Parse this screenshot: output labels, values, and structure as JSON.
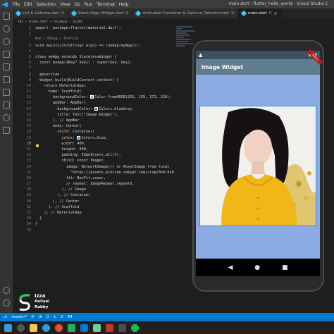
{
  "window": {
    "title": "main.dart - flutter_hello_world - Visual Studio C",
    "menu": [
      "File",
      "Edit",
      "Selection",
      "View",
      "Go",
      "Run",
      "Terminal",
      "Help"
    ]
  },
  "tabs": [
    {
      "label": "List & Listview.dart",
      "badge": "U"
    },
    {
      "label": "Stack Align Widget.dart",
      "badge": "U"
    },
    {
      "label": "Animated Container & Gesture Detector.dart",
      "badge": "U"
    },
    {
      "label": "main.dart",
      "badge": "U"
    }
  ],
  "breadcrumb": [
    "lib",
    "main.dart",
    "myApp",
    "build"
  ],
  "editor": {
    "codelens": "Run | Debug | Profile",
    "lines": [
      {
        "n": "1",
        "text": "import 'package:flutter/material.dart';"
      },
      {
        "n": "2",
        "text": ""
      },
      {
        "n": "",
        "text": "Run | Debug | Profile",
        "lens": true
      },
      {
        "n": "3",
        "text": "void main(List<String> args) => runApp(myApp());"
      },
      {
        "n": "4",
        "text": ""
      },
      {
        "n": "5",
        "text": "class myApp extends StatelessWidget {"
      },
      {
        "n": "6",
        "text": "  const myApp({Key? key}) : super(key: key);"
      },
      {
        "n": "7",
        "text": ""
      },
      {
        "n": "8",
        "text": "  @override"
      },
      {
        "n": "9",
        "text": "  Widget build(BuildContext context) {"
      },
      {
        "n": "10",
        "text": "    return MaterialApp("
      },
      {
        "n": "11",
        "text": "      home: Scaffold("
      },
      {
        "n": "12",
        "text": "        backgroundColor:  Color.fromARGB(255, 139, 171, 226),",
        "swatch": "#8babe2"
      },
      {
        "n": "13",
        "text": "        appBar: AppBar("
      },
      {
        "n": "14",
        "text": "          backgroundColor:  Colors.blueGrey,",
        "swatch": "#607d8b"
      },
      {
        "n": "15",
        "text": "          title: Text(\"Image Widget\"),"
      },
      {
        "n": "16",
        "text": "        ), // AppBar"
      },
      {
        "n": "17",
        "text": "        body: Center("
      },
      {
        "n": "18",
        "text": "          child: Container("
      },
      {
        "n": "19",
        "text": "            color:  Colors.blue,",
        "swatch": "#2196f3"
      },
      {
        "n": "20",
        "text": "            width: 400,"
      },
      {
        "n": "21",
        "text": "            height: 400,"
      },
      {
        "n": "22",
        "text": "            padding: EdgeInsets.all(3),"
      },
      {
        "n": "23",
        "text": "            child: const Image("
      },
      {
        "n": "24",
        "text": "              image: NetworkImage(// or AssetImage from local"
      },
      {
        "n": "25",
        "text": "                \"https://assets.pikiran-rakyat.com/crop/0x0:0x0"
      },
      {
        "n": "26",
        "text": "              fit: BoxFit.cover,"
      },
      {
        "n": "27",
        "text": "              // repeat: ImageRepeat.repeatX,"
      },
      {
        "n": "28",
        "text": "            ), // Image"
      },
      {
        "n": "29",
        "text": "          ), // Container"
      },
      {
        "n": "30",
        "text": "        ), // Center"
      },
      {
        "n": "31",
        "text": "      ), // Scaffold"
      },
      {
        "n": "32",
        "text": "    ); // MaterialApp"
      },
      {
        "n": "33",
        "text": "  }"
      },
      {
        "n": "34",
        "text": "}"
      },
      {
        "n": "35",
        "text": ""
      }
    ],
    "current_line": "20"
  },
  "phone": {
    "appbar_title": "Image Widget",
    "debug_banner": "DEBUG",
    "colors": {
      "scaffold": "#8babe2",
      "appbar": "#5f7d8f",
      "container": "#2196f3"
    }
  },
  "brand": {
    "line1": "Izza",
    "line2": "Auliyai",
    "line3": "Rabby"
  },
  "statusbar": {
    "branch": "master*",
    "errors": "0",
    "warnings": "0",
    "count": "84"
  }
}
